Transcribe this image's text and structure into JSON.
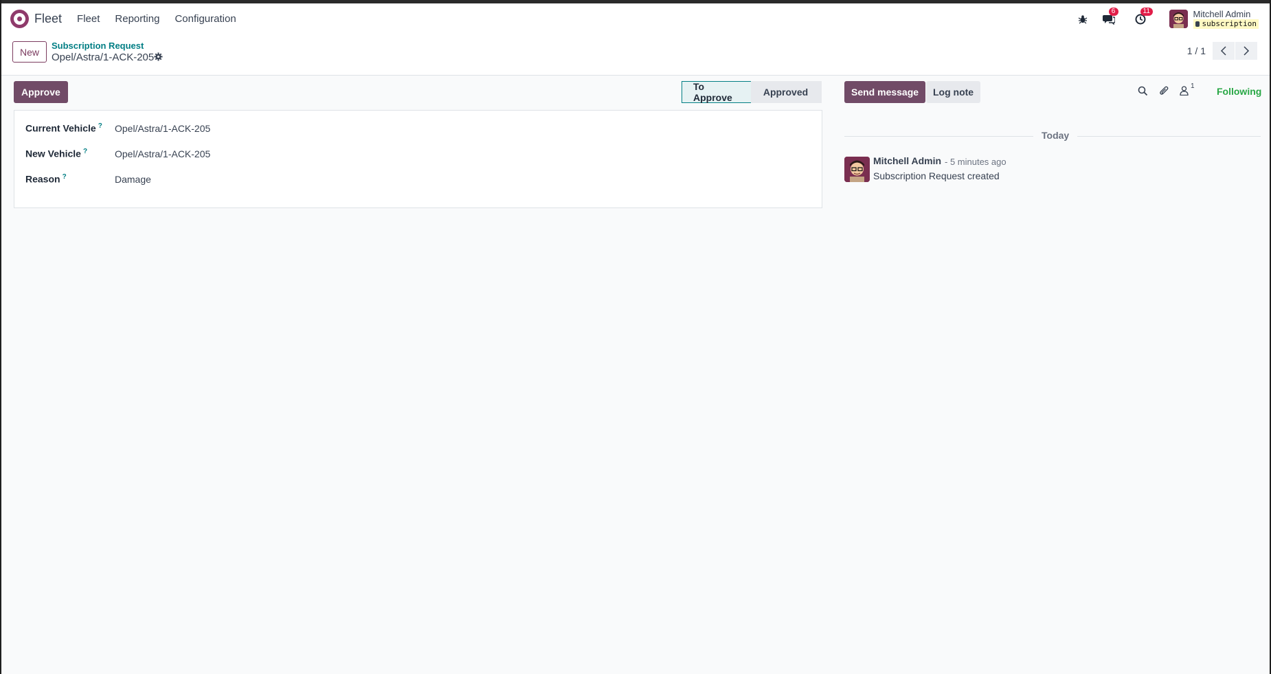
{
  "app": {
    "name": "Fleet"
  },
  "menu": [
    "Fleet",
    "Reporting",
    "Configuration"
  ],
  "systray": {
    "messages_count": "6",
    "activities_count": "11",
    "user_name": "Mitchell Admin",
    "database": "subscription"
  },
  "control_panel": {
    "new_label": "New",
    "breadcrumb_parent": "Subscription Request",
    "record_name": "Opel/Astra/1-ACK-205",
    "pager_value": "1 / 1"
  },
  "form": {
    "approve_label": "Approve",
    "status": {
      "current": "To Approve",
      "next": "Approved"
    },
    "fields": [
      {
        "label": "Current Vehicle",
        "help": "?",
        "value": "Opel/Astra/1-ACK-205"
      },
      {
        "label": "New Vehicle",
        "help": "?",
        "value": "Opel/Astra/1-ACK-205"
      },
      {
        "label": "Reason",
        "help": "?",
        "value": "Damage"
      }
    ]
  },
  "chatter": {
    "send_message_label": "Send message",
    "log_note_label": "Log note",
    "followers_count": "1",
    "following_label": "Following",
    "date_separator": "Today",
    "messages": [
      {
        "author": "Mitchell Admin",
        "time": "- 5 minutes ago",
        "body": "Subscription Request created"
      }
    ]
  },
  "colors": {
    "brand": "#714b67",
    "accent_teal": "#017e84",
    "following_green": "#28a745",
    "badge_red": "#e11d48"
  },
  "icons": [
    "fleet-logo-icon",
    "bug-icon",
    "chat-icon",
    "clock-icon",
    "gear-icon",
    "chevron-left-icon",
    "chevron-right-icon",
    "search-icon",
    "paperclip-icon",
    "user-icon"
  ]
}
